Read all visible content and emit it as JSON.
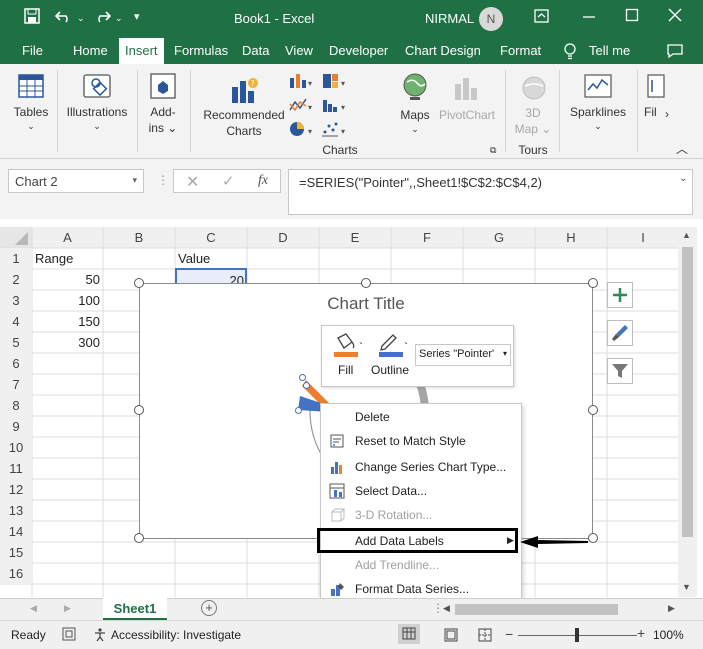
{
  "app": {
    "title": "Book1  -  Excel",
    "user": "NIRMAL",
    "user_initial": "N"
  },
  "tabs": [
    "File",
    "Home",
    "Insert",
    "Formulas",
    "Data",
    "View",
    "Developer",
    "Chart Design",
    "Format"
  ],
  "tell_me": "Tell me",
  "ribbon": {
    "tables": "Tables",
    "illustrations": "Illustrations",
    "addins_1": "Add-",
    "addins_2": "ins",
    "recommended_1": "Recommended",
    "recommended_2": "Charts",
    "maps": "Maps",
    "pivotchart": "PivotChart",
    "map3d_1": "3D",
    "map3d_2": "Map",
    "sparklines": "Sparklines",
    "filters": "Fil",
    "group_charts": "Charts",
    "group_tours": "Tours"
  },
  "formula_bar": {
    "name_box": "Chart 2",
    "fx": "fx",
    "formula": "=SERIES(\"Pointer\",,Sheet1!$C$2:$C$4,2)"
  },
  "columns": [
    "A",
    "B",
    "C",
    "D",
    "E",
    "F",
    "G",
    "H",
    "I"
  ],
  "rows": [
    "1",
    "2",
    "3",
    "4",
    "5",
    "6",
    "7",
    "8",
    "9",
    "10",
    "11",
    "12",
    "13",
    "14",
    "15",
    "16"
  ],
  "cells": {
    "A1": "Range",
    "C1": "Value",
    "A2": "50",
    "C2": "20",
    "A3": "100",
    "A4": "150",
    "A5": "300"
  },
  "chart": {
    "title": "Chart Title"
  },
  "mini_toolbar": {
    "fill": "Fill",
    "outline": "Outline",
    "series_select": "Series \"Pointer'"
  },
  "context_menu": [
    {
      "label": "Delete",
      "enabled": true
    },
    {
      "label": "Reset to Match Style",
      "enabled": true
    },
    {
      "label": "Change Series Chart Type...",
      "enabled": true
    },
    {
      "label": "Select Data...",
      "enabled": true
    },
    {
      "label": "3-D Rotation...",
      "enabled": false
    },
    {
      "label": "Add Data Labels",
      "enabled": true
    },
    {
      "label": "Add Trendline...",
      "enabled": false
    },
    {
      "label": "Format Data Series...",
      "enabled": true
    }
  ],
  "sheet_tab": "Sheet1",
  "status": {
    "ready": "Ready",
    "accessibility": "Accessibility: Investigate",
    "zoom": "100%"
  },
  "colors": {
    "excel_green": "#1f7145",
    "pie_orange": "#ed7d31",
    "pie_blue": "#4472c4",
    "highlight_border": "#000000"
  }
}
